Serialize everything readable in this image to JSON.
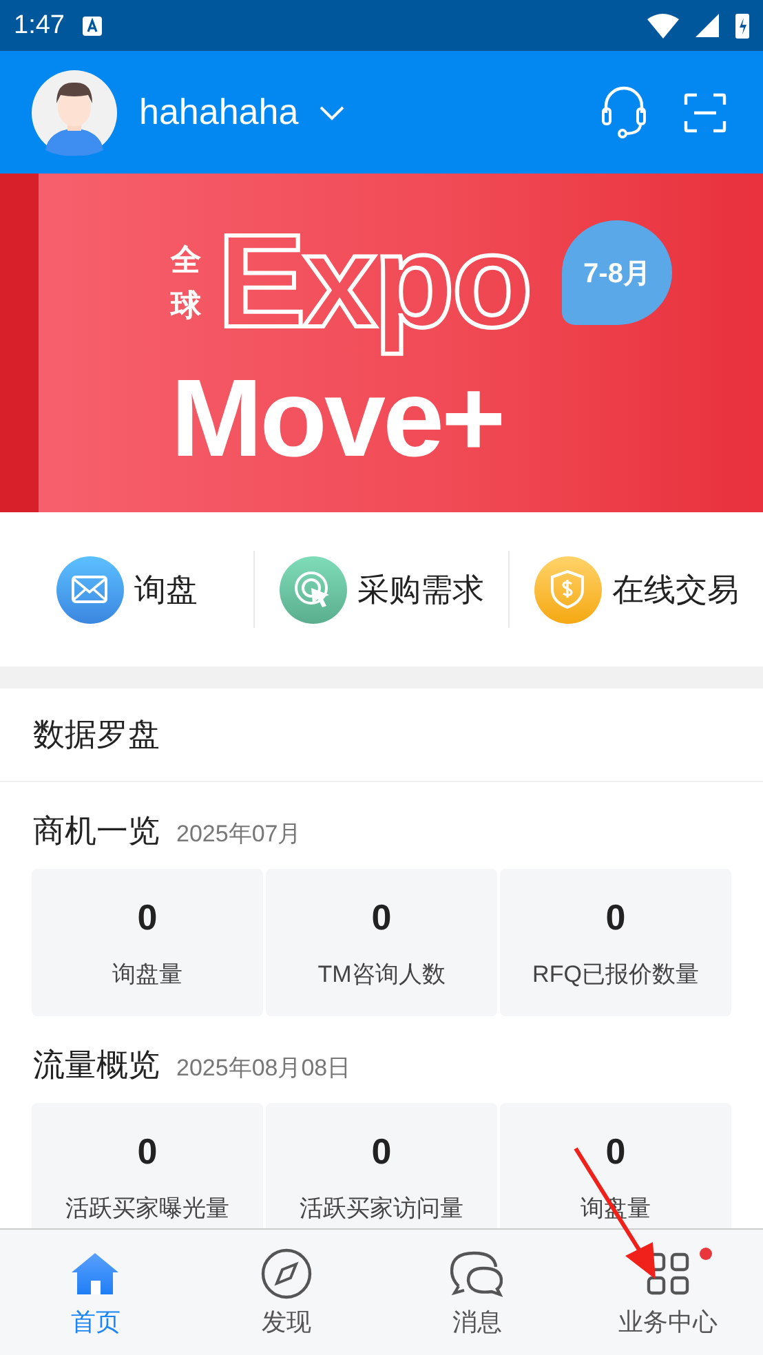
{
  "status_bar": {
    "time": "1:47"
  },
  "header": {
    "username": "hahahaha"
  },
  "banner": {
    "side_text": "全球",
    "title": "Expo",
    "subtitle": "Move+",
    "badge": "7-8月"
  },
  "quick_actions": [
    {
      "kind": "mail",
      "label": "询盘"
    },
    {
      "kind": "target",
      "label": "采购需求"
    },
    {
      "kind": "shield",
      "label": "在线交易"
    }
  ],
  "dashboard": {
    "title": "数据罗盘",
    "sections": [
      {
        "title": "商机一览",
        "date": "2025年07月",
        "stats": [
          {
            "value": "0",
            "label": "询盘量"
          },
          {
            "value": "0",
            "label": "TM咨询人数"
          },
          {
            "value": "0",
            "label": "RFQ已报价数量"
          }
        ]
      },
      {
        "title": "流量概览",
        "date": "2025年08月08日",
        "stats": [
          {
            "value": "0",
            "label": "活跃买家曝光量"
          },
          {
            "value": "0",
            "label": "活跃买家访问量"
          },
          {
            "value": "0",
            "label": "询盘量"
          }
        ]
      }
    ]
  },
  "tab_bar": [
    {
      "kind": "home",
      "label": "首页",
      "selected": true,
      "dot": false
    },
    {
      "kind": "compass",
      "label": "发现",
      "selected": false,
      "dot": false
    },
    {
      "kind": "chat",
      "label": "消息",
      "selected": false,
      "dot": false
    },
    {
      "kind": "grid",
      "label": "业务中心",
      "selected": false,
      "dot": true
    }
  ]
}
